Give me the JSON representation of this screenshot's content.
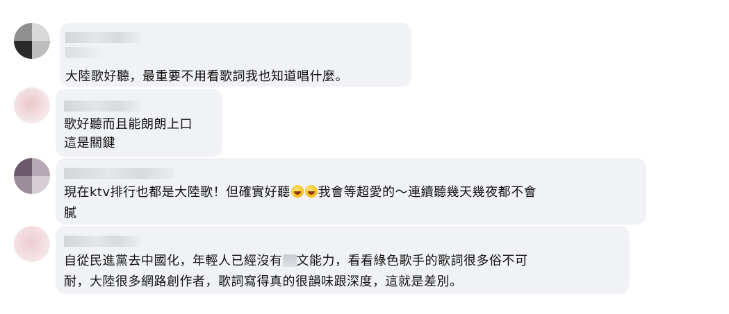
{
  "comments": [
    {
      "lines": [
        "大陸歌好聽，最重要不用看歌詞我也知道唱什麼。"
      ]
    },
    {
      "lines": [
        "歌好聽而且能朗朗上口",
        "這是關鍵"
      ]
    },
    {
      "line1_before": "現在ktv排行也都是大陸歌！但確實好聽",
      "emoji": "rolling-on-floor-laughing-emoji",
      "line1_after": "我會等超愛的～連續聽幾天幾夜都不會",
      "line2": "膩"
    },
    {
      "line1_before": "自從民進黨去中國化，年輕人已經沒有",
      "line1_after": "文能力，看看綠色歌手的歌詞很多俗不可",
      "line2": "耐，大陸很多網路創作者，歌詞寫得真的很韻味跟深度，這就是差別。"
    }
  ]
}
